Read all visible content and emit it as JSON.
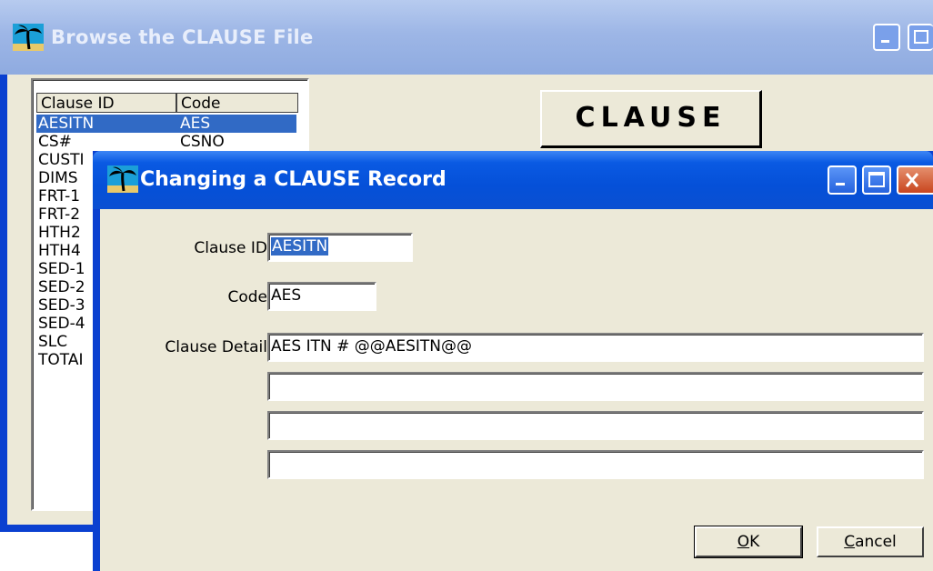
{
  "back_window": {
    "title": "Browse the CLAUSE File",
    "list": {
      "headers": [
        "Clause ID",
        "Code"
      ],
      "rows": [
        {
          "id": "AESITN",
          "code": "AES",
          "selected": true
        },
        {
          "id": "CS#",
          "code": "CSNO"
        },
        {
          "id": "CUSTI",
          "code": ""
        },
        {
          "id": "DIMS",
          "code": ""
        },
        {
          "id": "FRT-1",
          "code": ""
        },
        {
          "id": "FRT-2",
          "code": ""
        },
        {
          "id": "HTH2",
          "code": ""
        },
        {
          "id": "HTH4",
          "code": ""
        },
        {
          "id": "SED-1",
          "code": ""
        },
        {
          "id": "SED-2",
          "code": ""
        },
        {
          "id": "SED-3",
          "code": ""
        },
        {
          "id": "SED-4",
          "code": ""
        },
        {
          "id": "SLC",
          "code": ""
        },
        {
          "id": "TOTAI",
          "code": ""
        }
      ]
    },
    "banner": "CLAUSE"
  },
  "dialog": {
    "title": "Changing a CLAUSE Record",
    "fields": {
      "clause_id_label": "Clause ID",
      "clause_id_value": "AESITN",
      "code_label": "Code",
      "code_value": "AES",
      "detail_label": "Clause Detail",
      "detail_lines": [
        "AES ITN # @@AESITN@@",
        "",
        "",
        ""
      ]
    },
    "ok_mnemonic": "O",
    "ok_rest": "K",
    "cancel_mnemonic": "C",
    "cancel_rest": "ancel"
  },
  "colors": {
    "titlebar_active": "#0a5ae3",
    "titlebar_inactive": "#9db6e6",
    "window_face": "#ece9d8",
    "selection": "#316ac5"
  },
  "icons": {
    "app": "palm-tree-icon",
    "minimize": "minimize-icon",
    "maximize": "maximize-icon",
    "close": "close-icon"
  }
}
